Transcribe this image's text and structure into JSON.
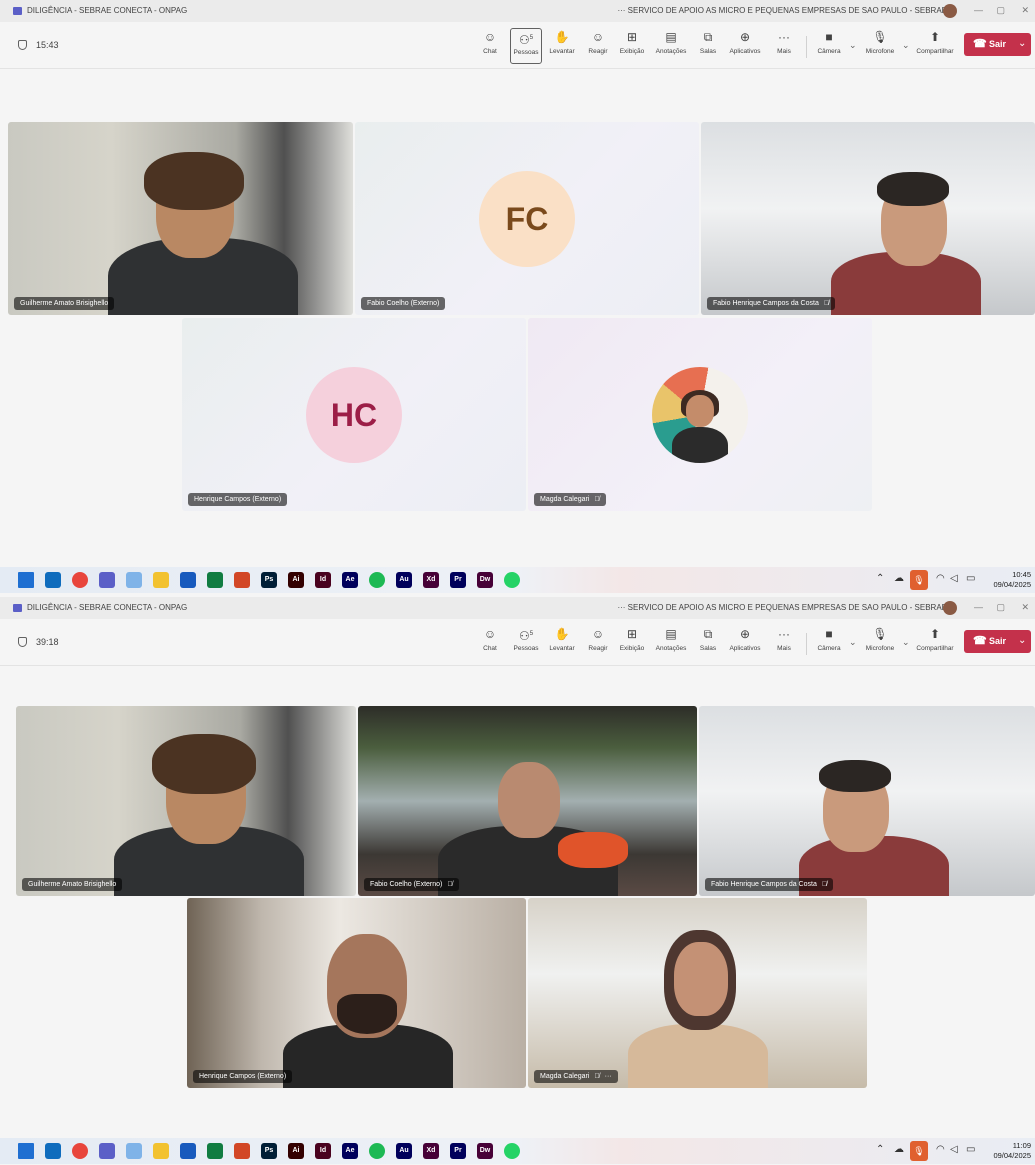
{
  "screens": [
    {
      "title_left": "DILIGÊNCIA - SEBRAE CONECTA - ONPAG",
      "title_right": "··· SERVICO DE APOIO AS MICRO E PEQUENAS EMPRESAS DE SAO PAULO - SEBRAE",
      "timer": "15:43",
      "participants_count": "5",
      "toolbar": [
        "Chat",
        "Pessoas",
        "Levantar",
        "Reagir",
        "Exibição",
        "Anotações",
        "Salas",
        "Aplicativos",
        "Mais",
        "Câmera",
        "Microfone",
        "Compartilhar"
      ],
      "leave_label": "Sair",
      "tiles": [
        {
          "name": "Guilherme Amato Brisighello",
          "muted": false,
          "initials": ""
        },
        {
          "name": "Fabio Coelho (Externo)",
          "muted": false,
          "initials": "FC"
        },
        {
          "name": "Fabio Henrique Campos da Costa",
          "muted": true,
          "initials": ""
        },
        {
          "name": "Henrique Campos (Externo)",
          "muted": false,
          "initials": "HC"
        },
        {
          "name": "Magda Calegari",
          "muted": true,
          "initials": ""
        }
      ],
      "clock_time": "10:45",
      "clock_date": "09/04/2025"
    },
    {
      "title_left": "DILIGÊNCIA - SEBRAE CONECTA - ONPAG",
      "title_right": "··· SERVICO DE APOIO AS MICRO E PEQUENAS EMPRESAS DE SAO PAULO - SEBRAE",
      "timer": "39:18",
      "participants_count": "5",
      "toolbar": [
        "Chat",
        "Pessoas",
        "Levantar",
        "Reagir",
        "Exibição",
        "Anotações",
        "Salas",
        "Aplicativos",
        "Mais",
        "Câmera",
        "Microfone",
        "Compartilhar"
      ],
      "leave_label": "Sair",
      "tiles": [
        {
          "name": "Guilherme Amato Brisighello",
          "muted": false
        },
        {
          "name": "Fabio Coelho (Externo)",
          "muted": true
        },
        {
          "name": "Fabio Henrique Campos da Costa",
          "muted": true
        },
        {
          "name": "Henrique Campos (Externo)",
          "muted": false
        },
        {
          "name": "Magda Calegari",
          "muted": true,
          "more": "···"
        }
      ],
      "clock_time": "11:09",
      "clock_date": "09/04/2025"
    }
  ],
  "taskbar_apps": [
    {
      "icon": "windows-start-icon",
      "label": "",
      "color": "#1f6fd1"
    },
    {
      "icon": "outlook-icon",
      "label": "",
      "color": "#0f6cbd"
    },
    {
      "icon": "chrome-icon",
      "label": "",
      "color": "#e8453c"
    },
    {
      "icon": "teams-icon",
      "label": "",
      "color": "#5b5fc7"
    },
    {
      "icon": "copilot-icon",
      "label": "",
      "color": "#7fb3e8"
    },
    {
      "icon": "file-explorer-icon",
      "label": "",
      "color": "#f2c230"
    },
    {
      "icon": "word-icon",
      "label": "",
      "color": "#185abd"
    },
    {
      "icon": "excel-icon",
      "label": "",
      "color": "#107c41"
    },
    {
      "icon": "powerpoint-icon",
      "label": "",
      "color": "#d24726"
    },
    {
      "icon": "photoshop-icon",
      "label": "Ps",
      "color": "#001e36"
    },
    {
      "icon": "illustrator-icon",
      "label": "Ai",
      "color": "#330000"
    },
    {
      "icon": "indesign-icon",
      "label": "Id",
      "color": "#49021f"
    },
    {
      "icon": "after-effects-icon",
      "label": "Ae",
      "color": "#00005b"
    },
    {
      "icon": "spotify-icon",
      "label": "",
      "color": "#1db954"
    },
    {
      "icon": "audition-icon",
      "label": "Au",
      "color": "#00005b"
    },
    {
      "icon": "xd-icon",
      "label": "Xd",
      "color": "#470137"
    },
    {
      "icon": "premiere-icon",
      "label": "Pr",
      "color": "#00005b"
    },
    {
      "icon": "dreamweaver-icon",
      "label": "Dw",
      "color": "#470137"
    },
    {
      "icon": "whatsapp-icon",
      "label": "",
      "color": "#25d366"
    }
  ]
}
